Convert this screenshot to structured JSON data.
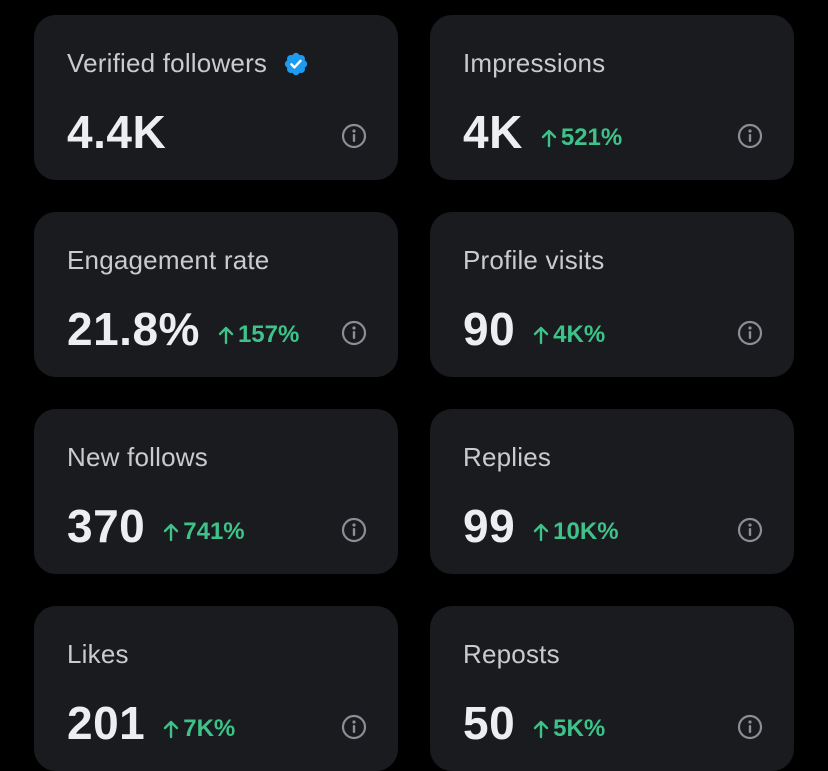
{
  "colors": {
    "background": "#000000",
    "card": "#1a1b1f",
    "label": "#c9cbcf",
    "value": "#eceef0",
    "positive": "#3ec28a",
    "verified_badge": "#1d9bf0",
    "info_icon": "#8b8e94"
  },
  "metrics": [
    {
      "label": "Verified followers",
      "value": "4.4K",
      "delta": "",
      "badge": "verified-badge-icon",
      "info_icon": "info-icon"
    },
    {
      "label": "Impressions",
      "value": "4K",
      "delta": "521%",
      "info_icon": "info-icon"
    },
    {
      "label": "Engagement rate",
      "value": "21.8%",
      "delta": "157%",
      "info_icon": "info-icon"
    },
    {
      "label": "Profile visits",
      "value": "90",
      "delta": "4K%",
      "info_icon": "info-icon"
    },
    {
      "label": "New follows",
      "value": "370",
      "delta": "741%",
      "info_icon": "info-icon"
    },
    {
      "label": "Replies",
      "value": "99",
      "delta": "10K%",
      "info_icon": "info-icon"
    },
    {
      "label": "Likes",
      "value": "201",
      "delta": "7K%",
      "info_icon": "info-icon"
    },
    {
      "label": "Reposts",
      "value": "50",
      "delta": "5K%",
      "info_icon": "info-icon"
    }
  ]
}
